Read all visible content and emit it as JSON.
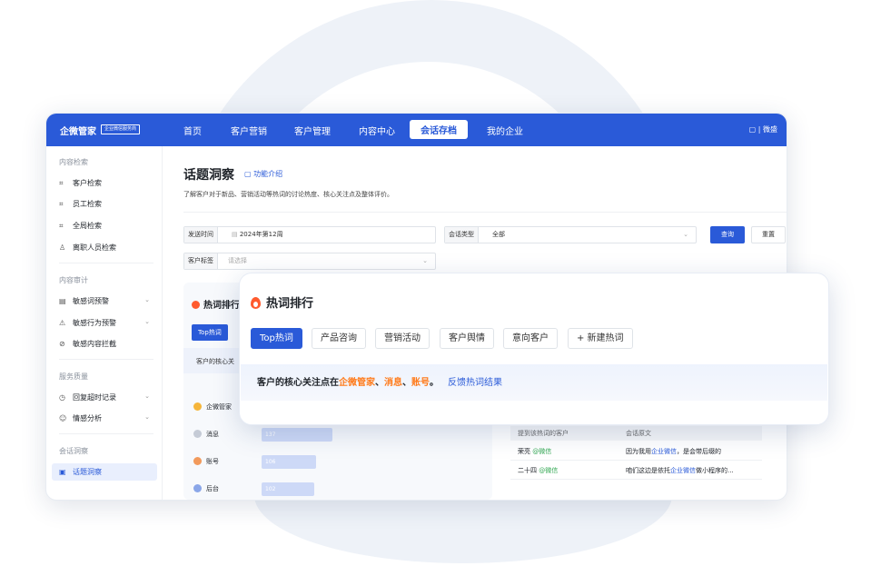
{
  "app": {
    "logo": "企微管家",
    "logo_badge": "企业微信服务商",
    "nav": [
      "首页",
      "客户营销",
      "客户管理",
      "内容中心",
      "会话存档",
      "我的企业"
    ],
    "nav_active": "会话存档",
    "top_right": "|  微盛"
  },
  "sidebar": {
    "group1": "内容检索",
    "items1": [
      "客户检索",
      "员工检索",
      "全局检索",
      "离职人员检索"
    ],
    "group2": "内容审计",
    "items2": [
      "敏感词预警",
      "敏感行为预警",
      "敏感内容拦截"
    ],
    "group3": "服务质量",
    "items3": [
      "回复超时记录",
      "情感分析"
    ],
    "group4": "会话洞察",
    "items4": [
      "话题洞察"
    ]
  },
  "page": {
    "title": "话题洞察",
    "feature_link": "功能介绍",
    "subtitle": "了解客户对于新品、营销活动等热词的讨论热度、核心关注点及整体评价。"
  },
  "filters": {
    "send_time_label": "发送时间",
    "send_time_value": "2024年第12周",
    "session_type_label": "会话类型",
    "session_type_value": "全部",
    "customer_tag_label": "客户标签",
    "customer_tag_placeholder": "请选择",
    "query_button": "查询",
    "reset_button": "重置"
  },
  "panel": {
    "title": "热词排行",
    "tab": "Top热词",
    "note": "客户的核心关"
  },
  "ranking": [
    {
      "label": "企微管家",
      "value": ""
    },
    {
      "label": "消息",
      "value": "137"
    },
    {
      "label": "账号",
      "value": "106"
    },
    {
      "label": "后台",
      "value": "102"
    }
  ],
  "table": {
    "headers": [
      "提到该热词的客户",
      "会话原文"
    ],
    "rows": [
      {
        "customer": "荣亮",
        "tag": "@微信",
        "text_pre": "因为我用",
        "text_hl": "企业微信",
        "text_post": "，是会带后缀的"
      },
      {
        "customer": "二十四",
        "tag": "@微信",
        "text_pre": "咱们这边是依托",
        "text_hl": "企业微信",
        "text_post": "做小程序的..."
      }
    ]
  },
  "popup": {
    "title": "热词排行",
    "tabs": [
      "Top热词",
      "产品咨询",
      "营销活动",
      "客户舆情",
      "意向客户",
      "+ 新建热词"
    ],
    "note_prefix": "客户的核心关注点在",
    "note_kw1": "企微管家",
    "note_sep1": "、",
    "note_kw2": "消息",
    "note_sep2": "、",
    "note_kw3": "账号",
    "note_suffix": "。",
    "feedback_link": "反馈热词结果"
  }
}
